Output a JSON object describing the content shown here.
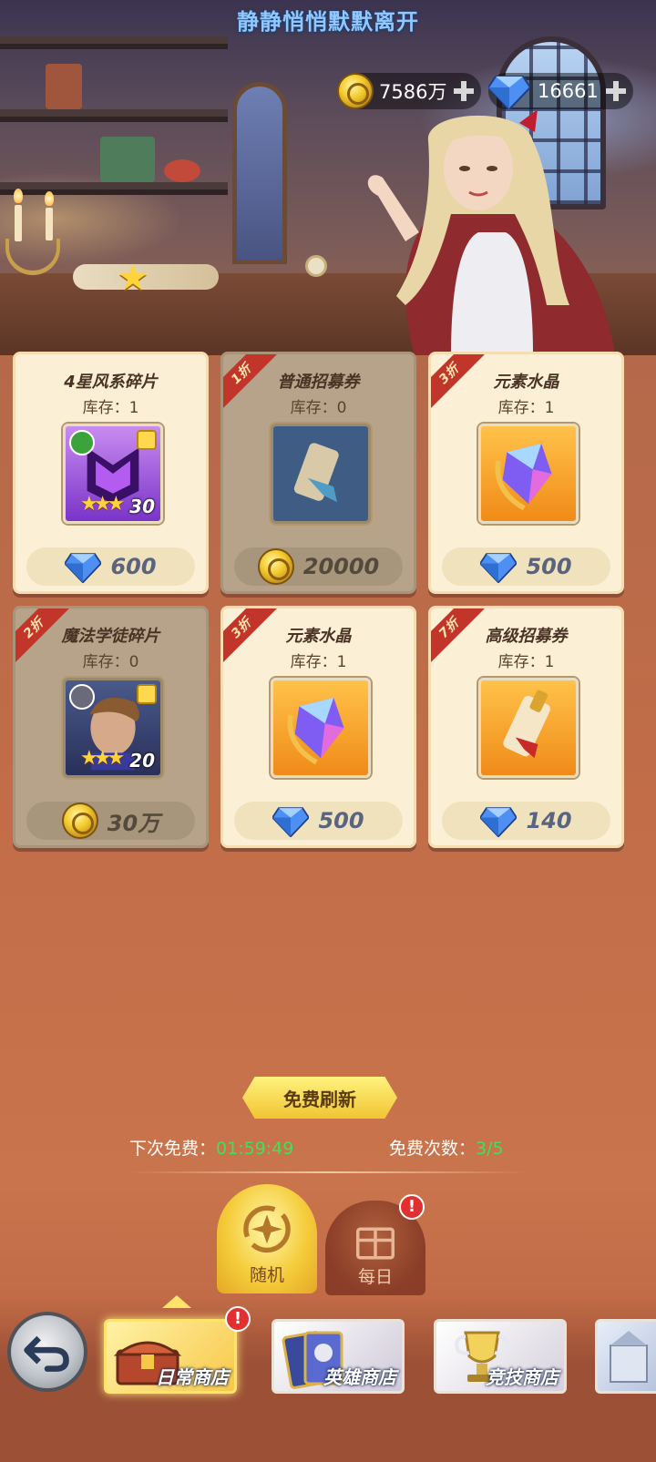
{
  "header": {
    "title": "静静悄悄默默离开",
    "gold": {
      "icon": "gold-coin-icon",
      "value": "7586万"
    },
    "diamond": {
      "icon": "diamond-icon",
      "value": "16661"
    }
  },
  "items": [
    {
      "name": "4星风系碎片",
      "stock": "库存：1",
      "discount": "",
      "price": "600",
      "currency": "diamond",
      "sold_out": false,
      "icon": "wind-hero-shard-icon",
      "stars": 3,
      "level": "30"
    },
    {
      "name": "普通招募券",
      "stock": "库存：0",
      "discount": "1折",
      "price": "20000",
      "currency": "gold",
      "sold_out": true,
      "icon": "scroll-icon"
    },
    {
      "name": "元素水晶",
      "stock": "库存：1",
      "discount": "3折",
      "price": "500",
      "currency": "diamond",
      "sold_out": false,
      "icon": "element-crystal-icon"
    },
    {
      "name": "魔法学徒碎片",
      "stock": "库存：0",
      "discount": "2折",
      "price": "30万",
      "currency": "gold",
      "sold_out": true,
      "icon": "apprentice-hero-shard-icon",
      "stars": 3,
      "level": "20"
    },
    {
      "name": "元素水晶",
      "stock": "库存：1",
      "discount": "3折",
      "price": "500",
      "currency": "diamond",
      "sold_out": false,
      "icon": "element-crystal-icon"
    },
    {
      "name": "高级招募券",
      "stock": "库存：1",
      "discount": "7折",
      "price": "140",
      "currency": "diamond",
      "sold_out": false,
      "icon": "gold-scroll-icon"
    }
  ],
  "refresh": {
    "button_label": "免费刷新",
    "next_free_label": "下次免费：",
    "next_free_time": "01:59:49",
    "free_count_label": "免费次数：",
    "free_count": "3/5"
  },
  "sub_tabs": [
    {
      "label": "随机",
      "active": true
    },
    {
      "label": "每日",
      "active": false,
      "badge": "!"
    }
  ],
  "shops": [
    {
      "label": "日常商店",
      "active": true,
      "badge": "!"
    },
    {
      "label": "英雄商店",
      "active": false
    },
    {
      "label": "竞技商店",
      "active": false
    }
  ],
  "colors": {
    "accent_gold": "#f5cd3c",
    "timer_green": "#40e05a",
    "badge_red": "#e23030",
    "ribbon_red": "#c1352a"
  }
}
